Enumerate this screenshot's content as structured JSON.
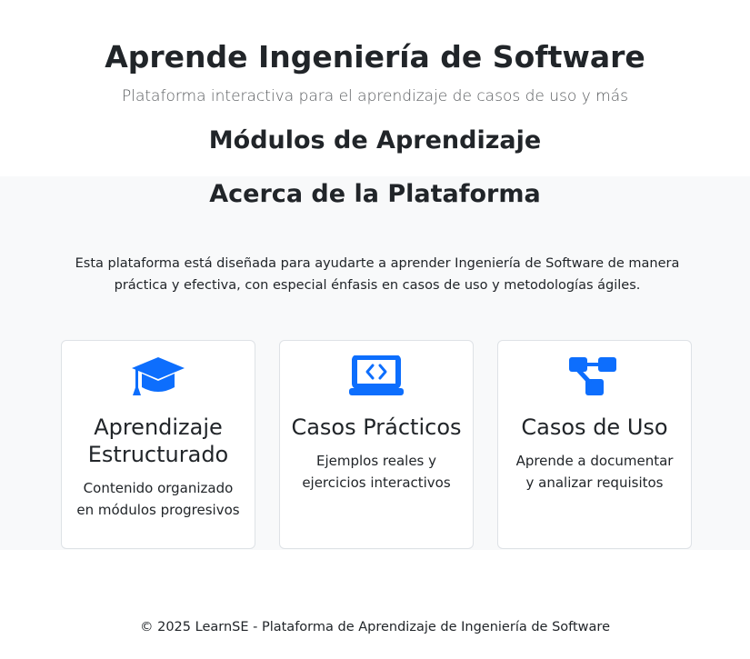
{
  "hero": {
    "title": "Aprende Ingeniería de Software",
    "subtitle": "Plataforma interactiva para el aprendizaje de casos de uso y más"
  },
  "modules": {
    "title": "Módulos de Aprendizaje"
  },
  "about": {
    "title": "Acerca de la Plataforma",
    "description": "Esta plataforma está diseñada para ayudarte a aprender Ingeniería de Software de manera práctica y efectiva, con especial énfasis en casos de uso y metodologías ágiles."
  },
  "features": [
    {
      "icon": "graduation-cap-icon",
      "title": "Aprendizaje Estructurado",
      "text": "Contenido organizado en módulos progresivos"
    },
    {
      "icon": "laptop-code-icon",
      "title": "Casos Prácticos",
      "text": "Ejemplos reales y ejercicios interactivos"
    },
    {
      "icon": "diagram-icon",
      "title": "Casos de Uso",
      "text": "Aprende a documentar y analizar requisitos"
    }
  ],
  "footer": {
    "text": "© 2025 LearnSE - Plataforma de Aprendizaje de Ingeniería de Software"
  },
  "colors": {
    "accent": "#0d6efd",
    "text": "#212529",
    "muted": "#595c5f",
    "section_bg": "#f8f9fa"
  }
}
